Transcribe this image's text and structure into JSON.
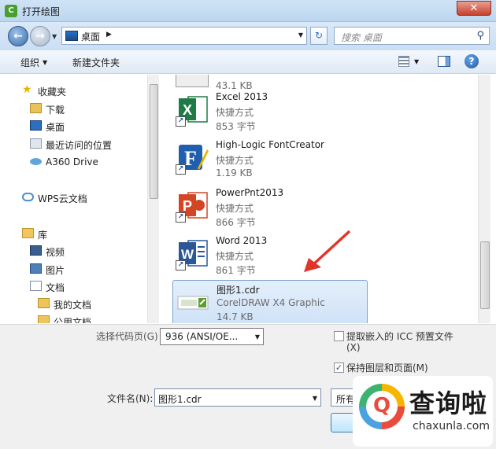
{
  "window": {
    "title": "打开绘图",
    "close_glyph": "✕"
  },
  "nav": {
    "address": "桌面",
    "search_placeholder": "搜索 桌面"
  },
  "toolbar": {
    "organize": "组织",
    "new_folder": "新建文件夹"
  },
  "sidebar": {
    "favorites": "收藏夹",
    "downloads": "下载",
    "desktop": "桌面",
    "recent": "最近访问的位置",
    "a360": "A360 Drive",
    "wps": "WPS云文档",
    "libraries": "库",
    "videos": "视频",
    "pictures": "图片",
    "documents": "文档",
    "my_docs": "我的文档",
    "public_docs": "公用文档"
  },
  "files": [
    {
      "name": "",
      "type": "",
      "size": "43.1 KB",
      "app": "partial",
      "icon_letter": "",
      "color": "#9a9a9a"
    },
    {
      "name": "Excel 2013",
      "type": "快捷方式",
      "size": "853 字节",
      "app": "excel",
      "icon_letter": "X",
      "color": "#1e7b45"
    },
    {
      "name": "High-Logic FontCreator",
      "type": "快捷方式",
      "size": "1.19 KB",
      "app": "fontcreator",
      "icon_letter": "F",
      "color": "#1f5fae"
    },
    {
      "name": "PowerPnt2013",
      "type": "快捷方式",
      "size": "866 字节",
      "app": "powerpoint",
      "icon_letter": "P",
      "color": "#d24625"
    },
    {
      "name": "Word 2013",
      "type": "快捷方式",
      "size": "861 字节",
      "app": "word",
      "icon_letter": "W",
      "color": "#2b5797"
    },
    {
      "name": "图形1.cdr",
      "type": "CorelDRAW X4 Graphic",
      "size": "14.7 KB",
      "app": "cdr",
      "icon_letter": "",
      "color": "#5a9e2f"
    }
  ],
  "options": {
    "codepage_label": "选择代码页(G)",
    "codepage_value": "936  (ANSI/OE...",
    "icc_label_line1": "提取嵌入的 ICC 预置文件",
    "icc_label_line2": "(X)",
    "icc_checked": false,
    "layers_label": "保持图层和页面(M)",
    "layers_checked": true,
    "filename_label": "文件名(N):",
    "filename_value": "图形1.cdr",
    "filter_value": "所有"
  },
  "watermark": {
    "text": "查询啦",
    "url": "chaxunla.com"
  },
  "colors": {
    "arrow": "#e0352b",
    "selection": "#cfe2f7",
    "title_bar": "#bcd6ef"
  }
}
